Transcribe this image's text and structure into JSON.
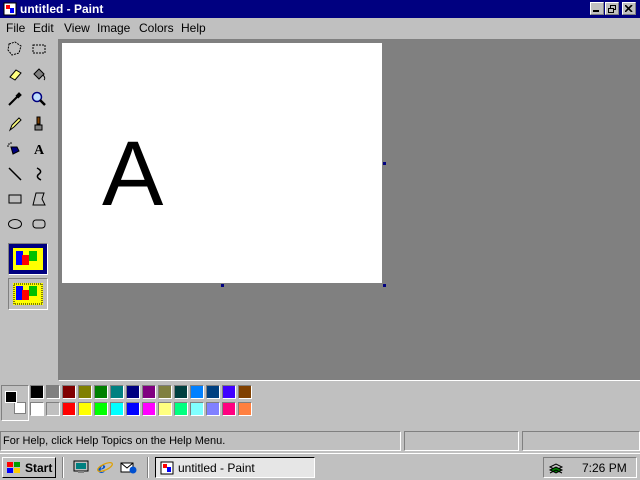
{
  "window": {
    "title": "untitled - Paint"
  },
  "menu": [
    "File",
    "Edit",
    "View",
    "Image",
    "Colors",
    "Help"
  ],
  "canvas": {
    "text": "A"
  },
  "palette": {
    "foreground": "#000000",
    "background": "#ffffff",
    "row1": [
      "#000000",
      "#808080",
      "#800000",
      "#808000",
      "#008000",
      "#008080",
      "#000080",
      "#800080",
      "#808040",
      "#004040",
      "#0080ff",
      "#004080",
      "#4000ff",
      "#804000"
    ],
    "row2": [
      "#ffffff",
      "#c0c0c0",
      "#ff0000",
      "#ffff00",
      "#00ff00",
      "#00ffff",
      "#0000ff",
      "#ff00ff",
      "#ffff80",
      "#00ff80",
      "#80ffff",
      "#8080ff",
      "#ff0080",
      "#ff8040"
    ]
  },
  "status": {
    "help": "For Help, click Help Topics on the Help Menu."
  },
  "taskbar": {
    "start": "Start",
    "task": "untitled - Paint",
    "clock": "7:26 PM"
  }
}
